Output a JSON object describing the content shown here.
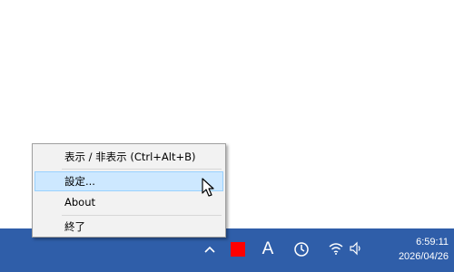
{
  "context_menu": {
    "items": [
      {
        "label": "表示 / 非表示  (Ctrl+Alt+B)"
      },
      {
        "label": "設定..."
      },
      {
        "label": "About"
      },
      {
        "label": "終了"
      }
    ]
  },
  "taskbar": {
    "tray": {
      "ime_label": "A",
      "icons": [
        "chevron-up-icon",
        "red-square-icon",
        "ime-mode-icon",
        "sync-clock-icon",
        "wifi-icon",
        "speaker-icon"
      ]
    },
    "clock": {
      "time": "6:59:11",
      "date": "2026/04/26"
    }
  },
  "colors": {
    "taskbar": "#2f5ea9",
    "menu_bg": "#f2f2f2",
    "selected_bg": "#cde8ff",
    "selected_border": "#99d1ff",
    "tray_red": "#ff0000"
  }
}
